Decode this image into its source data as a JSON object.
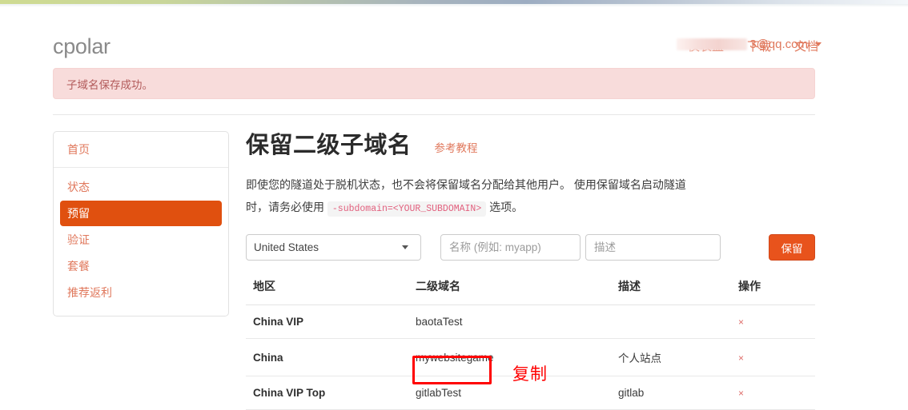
{
  "brand": "cpolar",
  "header": {
    "nav": [
      {
        "label": "仪表盘",
        "name": "nav-dashboard"
      },
      {
        "label": "下载",
        "name": "nav-download"
      },
      {
        "label": "文档",
        "name": "nav-docs"
      }
    ],
    "user_email": "3@qq.com",
    "user_email_redacted": true
  },
  "alert": {
    "text": "子域名保存成功。",
    "type": "success-pink",
    "bg_color": "#f8dcdb",
    "text_color": "#b25a5a"
  },
  "sidebar": {
    "header_label": "首页",
    "items": [
      {
        "label": "状态",
        "name": "sidebar-item-status",
        "active": false
      },
      {
        "label": "预留",
        "name": "sidebar-item-reserved",
        "active": true
      },
      {
        "label": "验证",
        "name": "sidebar-item-auth",
        "active": false
      },
      {
        "label": "套餐",
        "name": "sidebar-item-plan",
        "active": false
      },
      {
        "label": "推荐返利",
        "name": "sidebar-item-referral",
        "active": false
      }
    ],
    "active_color": "#e0500f",
    "link_color": "#e0785c"
  },
  "main": {
    "title": "保留二级子域名",
    "tutorial_link": "参考教程",
    "description_part1": "即使您的隧道处于脱机状态，也不会将保留域名分配给其他用户。 使用保留域名启动隧道时，请务必使用 ",
    "description_code": "-subdomain=<YOUR_SUBDOMAIN>",
    "description_part2": " 选项。"
  },
  "form": {
    "region_selected": "United States",
    "region_options": [
      "United States"
    ],
    "name_placeholder": "名称 (例如: myapp)",
    "name_value": "",
    "desc_placeholder": "描述",
    "desc_value": "",
    "submit_label": "保留",
    "submit_color": "#e8531c"
  },
  "table": {
    "columns": [
      "地区",
      "二级域名",
      "描述",
      "操作"
    ],
    "rows": [
      {
        "region": "China VIP",
        "subdomain": "baotaTest",
        "description": "",
        "action": "×"
      },
      {
        "region": "China",
        "subdomain": "mywebsitegame",
        "description": "个人站点",
        "action": "×"
      },
      {
        "region": "China VIP Top",
        "subdomain": "gitlabTest",
        "description": "gitlab",
        "action": "×"
      }
    ]
  },
  "annotations": {
    "highlight_target": "gitlabTest",
    "label": "复制",
    "color": "#ff0000"
  }
}
